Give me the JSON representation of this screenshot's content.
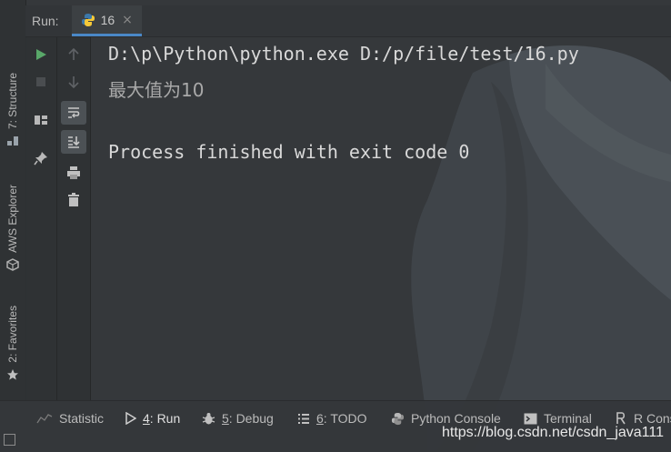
{
  "colors": {
    "accent_tab": "#4a88c7",
    "run_green": "#59a869",
    "python_blue": "#3c78aa",
    "python_yellow": "#f5c938"
  },
  "sidebar": {
    "tabs": [
      {
        "label": "7: Structure",
        "icon": "structure-icon"
      },
      {
        "label": "AWS Explorer",
        "icon": "aws-cube-icon"
      },
      {
        "label": "2: Favorites",
        "icon": "star-icon"
      }
    ]
  },
  "header": {
    "run_label": "Run:",
    "tab": {
      "name": "16",
      "icon": "python-icon",
      "close_icon": "close-icon"
    }
  },
  "toolbar": {
    "left_column": [
      "run-icon",
      "stop-icon",
      "layout-icon",
      "pin-icon"
    ],
    "right_column": [
      "up-arrow-icon",
      "down-arrow-icon",
      "soft-wrap-icon",
      "scroll-to-end-icon",
      "print-icon",
      "trash-icon"
    ]
  },
  "console": {
    "command": "D:\\p\\Python\\python.exe D:/p/file/test/16.py",
    "output": "最大值为10",
    "exit": "Process finished with exit code 0"
  },
  "bottom_bar": {
    "items": [
      {
        "label": "Statistic",
        "icon": "statistic-icon"
      },
      {
        "mnemonic": "4",
        "label": ": Run",
        "icon": "run-icon",
        "active": true
      },
      {
        "mnemonic": "5",
        "label": ": Debug",
        "icon": "debug-icon"
      },
      {
        "mnemonic": "6",
        "label": ": TODO",
        "icon": "todo-icon"
      },
      {
        "label": "Python Console",
        "icon": "python-icon"
      },
      {
        "label": "Terminal",
        "icon": "terminal-icon"
      },
      {
        "label": "R Cons",
        "icon": "r-console-icon"
      }
    ],
    "watermark": "https://blog.csdn.net/csdn_java111"
  }
}
